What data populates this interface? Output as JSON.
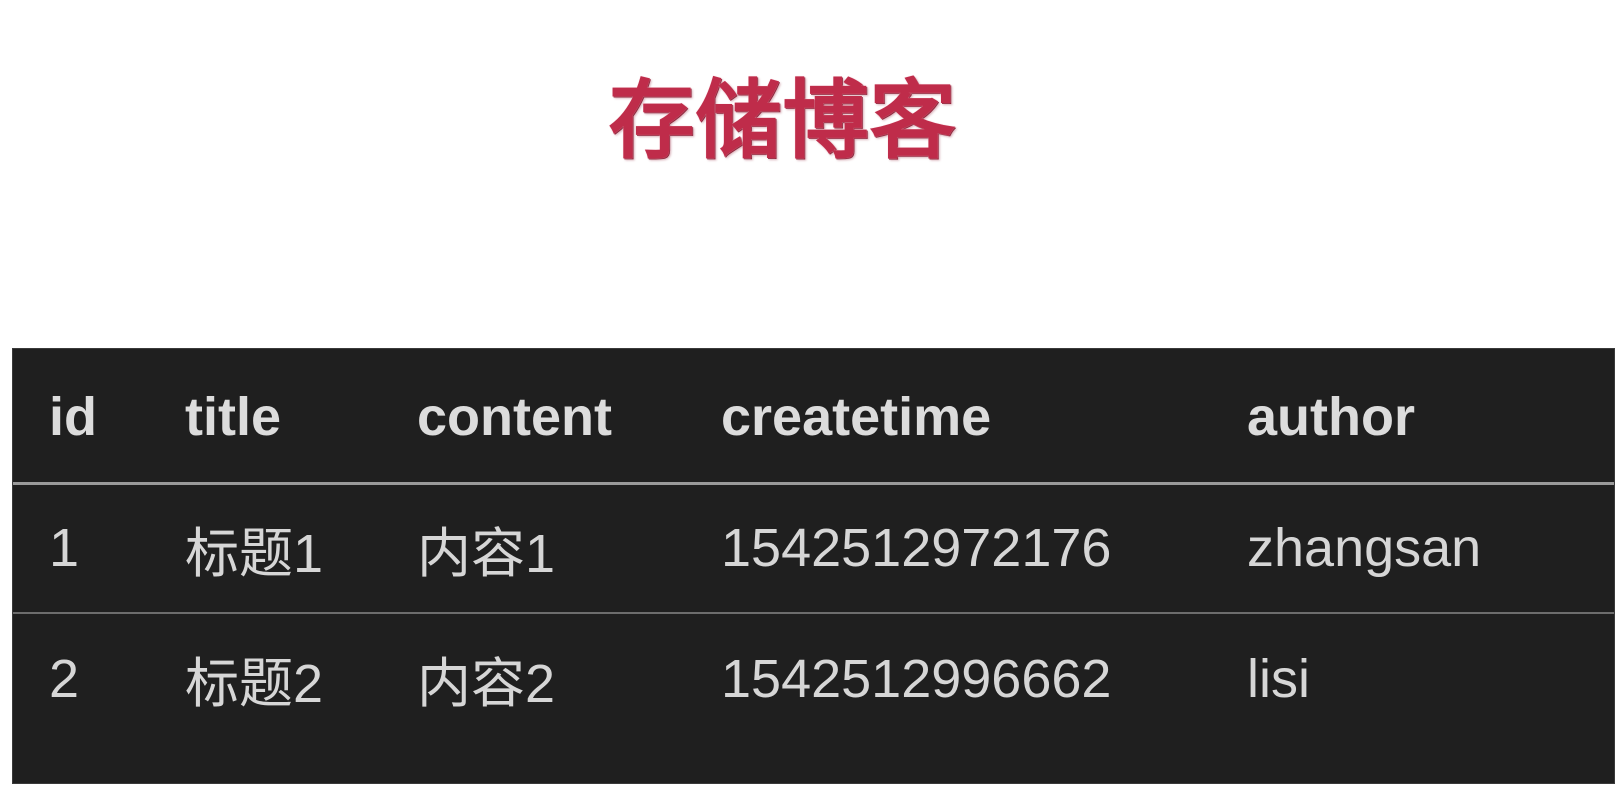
{
  "page": {
    "title": "存储博客",
    "title_color": "#bf2c4a",
    "background_color": "#ffffff"
  },
  "table": {
    "background_color": "#1f1f1f",
    "text_color": "#d6d6d6",
    "header_text_color": "#dcdcdc",
    "header_rule_color": "#9a9a9a",
    "row_rule_color": "#6d6d6d",
    "columns": [
      {
        "key": "id",
        "label": "id"
      },
      {
        "key": "title",
        "label": "title"
      },
      {
        "key": "content",
        "label": "content"
      },
      {
        "key": "createtime",
        "label": "createtime"
      },
      {
        "key": "author",
        "label": "author"
      }
    ],
    "rows": [
      {
        "id": "1",
        "title": "标题1",
        "content": "内容1",
        "createtime": "1542512972176",
        "author": "zhangsan"
      },
      {
        "id": "2",
        "title": "标题2",
        "content": "内容2",
        "createtime": "1542512996662",
        "author": "lisi"
      }
    ]
  }
}
